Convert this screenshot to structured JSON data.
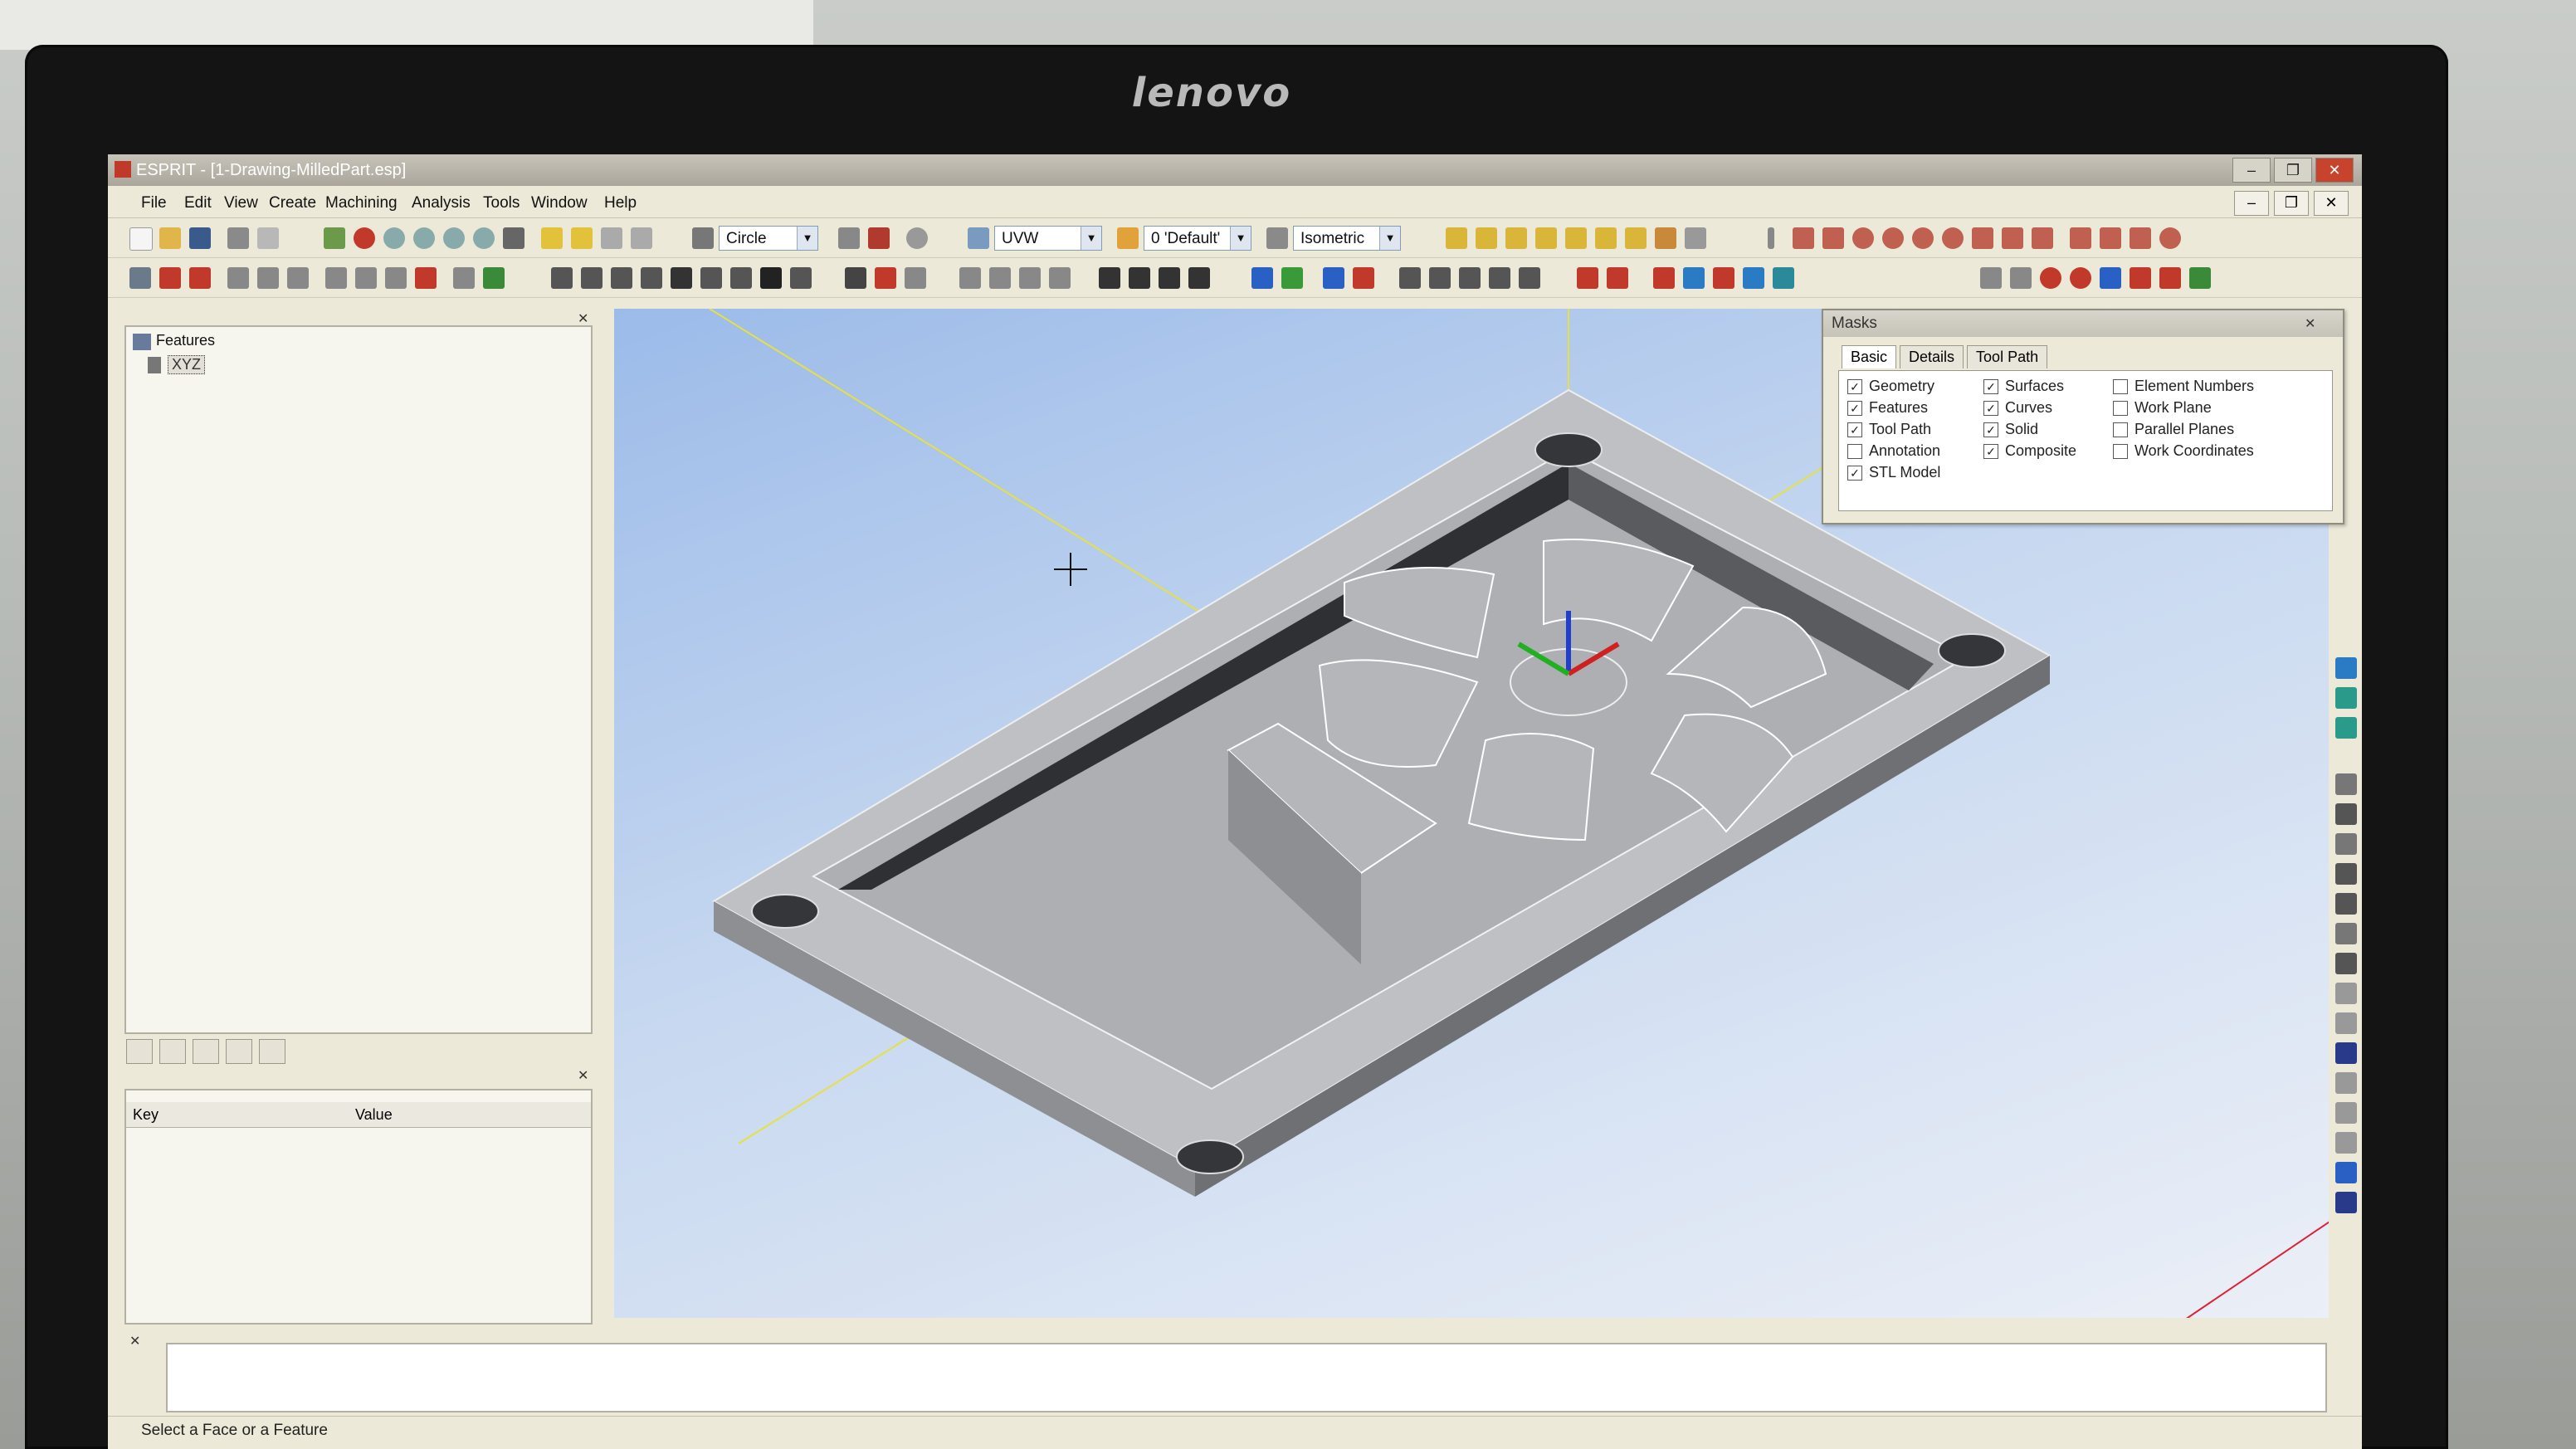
{
  "window": {
    "title": "ESPRIT - [1-Drawing-MilledPart.esp]"
  },
  "menu": [
    "File",
    "Edit",
    "View",
    "Create",
    "Machining",
    "Analysis",
    "Tools",
    "Window",
    "Help"
  ],
  "toolbar": {
    "select_mode": "Circle",
    "work_plane": "UVW",
    "layer": "0 'Default'",
    "view": "Isometric"
  },
  "feature_tree": {
    "root": "Features",
    "child": "XYZ"
  },
  "properties": {
    "col_key": "Key",
    "col_value": "Value"
  },
  "masks": {
    "title": "Masks",
    "tabs": [
      "Basic",
      "Details",
      "Tool Path"
    ],
    "col1": [
      {
        "label": "Geometry",
        "checked": true
      },
      {
        "label": "Features",
        "checked": true
      },
      {
        "label": "Tool Path",
        "checked": true
      },
      {
        "label": "Annotation",
        "checked": false
      },
      {
        "label": "STL Model",
        "checked": true
      }
    ],
    "col2": [
      {
        "label": "Surfaces",
        "checked": true
      },
      {
        "label": "Curves",
        "checked": true
      },
      {
        "label": "Solid",
        "checked": true
      },
      {
        "label": "Composite",
        "checked": true
      }
    ],
    "col3": [
      {
        "label": "Element Numbers",
        "checked": false
      },
      {
        "label": "Work Plane",
        "checked": false
      },
      {
        "label": "Parallel Planes",
        "checked": false
      },
      {
        "label": "Work Coordinates",
        "checked": false
      }
    ]
  },
  "status": {
    "message": "Select a Face or a Feature"
  },
  "brand": "lenovo"
}
